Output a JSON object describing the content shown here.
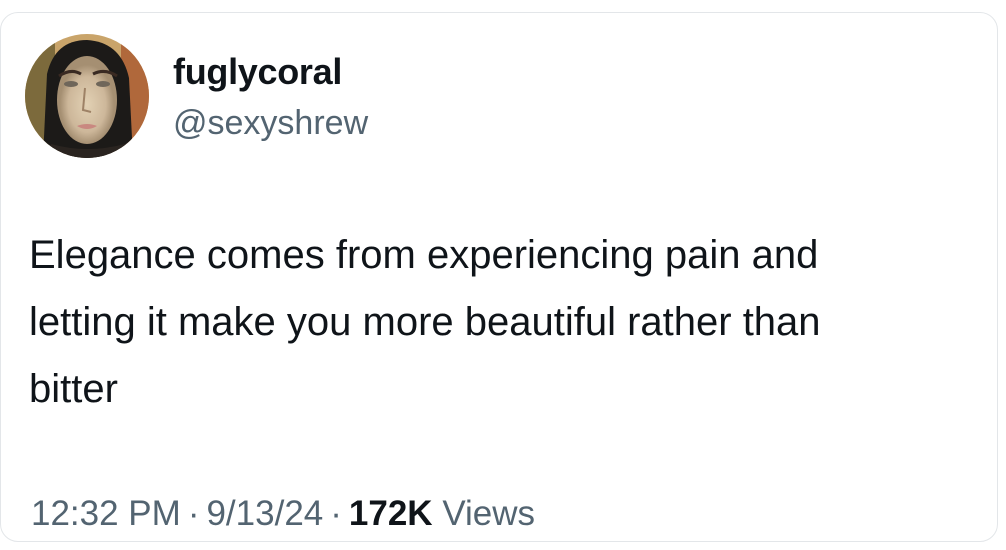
{
  "author": {
    "display_name": "fuglycoral",
    "handle": "@sexyshrew",
    "avatar_icon": "profile-photo-painted-portrait"
  },
  "tweet": {
    "text_lines": [
      "Elegance comes from experiencing pain and",
      "letting it make you more beautiful rather than",
      "bitter"
    ]
  },
  "meta": {
    "time": "12:32 PM",
    "separator": "·",
    "date": "9/13/24",
    "views_count": "172K",
    "views_label": "Views"
  },
  "colors": {
    "text_primary": "#0f1419",
    "text_secondary": "#536471",
    "card_border": "#e3e6e9"
  }
}
